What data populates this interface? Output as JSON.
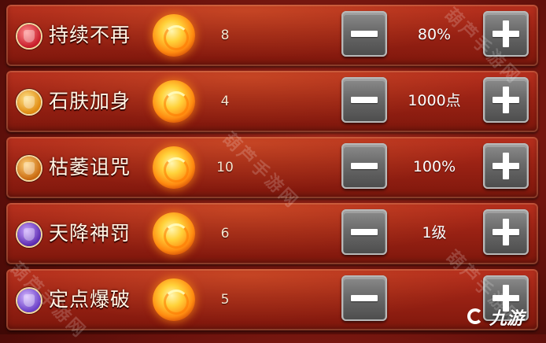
{
  "skills": [
    {
      "name": "持续不再",
      "cost": "8",
      "value": "80%",
      "icon": "red-shield-icon"
    },
    {
      "name": "石肤加身",
      "cost": "4",
      "value": "1000点",
      "icon": "gold-shield-icon"
    },
    {
      "name": "枯萎诅咒",
      "cost": "10",
      "value": "100%",
      "icon": "broken-heart-icon"
    },
    {
      "name": "天降神罚",
      "cost": "6",
      "value": "1级",
      "icon": "lightning-icon"
    },
    {
      "name": "定点爆破",
      "cost": "5",
      "value": "",
      "icon": "bomb-icon"
    }
  ],
  "cost_icon": "fire-orb-icon",
  "buttons": {
    "minus": "minus-icon",
    "plus": "plus-icon"
  },
  "watermark": "葫芦手游网",
  "logo": {
    "text": "九游",
    "icon": "jiuyou-logo-icon"
  },
  "colors": {
    "panel": "#9a2214",
    "button": "#6a6a6a",
    "text": "#fff6e6"
  }
}
